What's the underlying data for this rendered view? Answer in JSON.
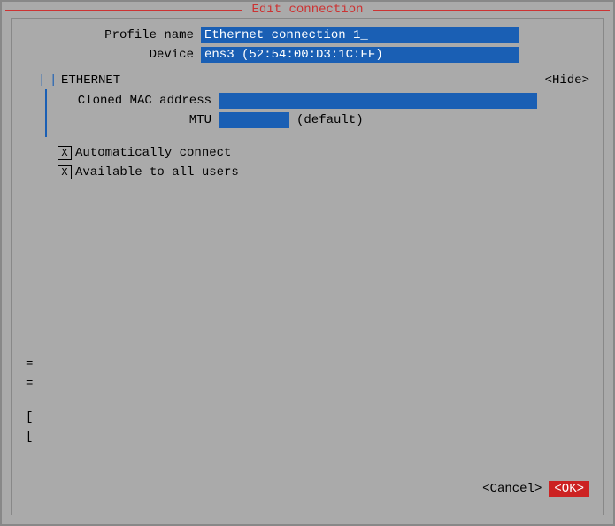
{
  "window": {
    "title": "Edit connection"
  },
  "form": {
    "profile_name_label": "Profile name",
    "profile_name_value": "Ethernet connection 1_",
    "device_label": "Device",
    "device_value": "ens3 (52:54:00:D3:1C:FF)",
    "ethernet_section_title": "ETHERNET",
    "hide_button": "<Hide>",
    "cloned_mac_label": "Cloned MAC address",
    "cloned_mac_value": "",
    "mtu_label": "MTU",
    "mtu_value": "",
    "mtu_default_text": "(default)",
    "auto_connect_label": "Automatically connect",
    "auto_connect_checked": true,
    "all_users_label": "Available to all users",
    "all_users_checked": true,
    "cancel_button": "<Cancel>",
    "ok_button": "<OK>"
  },
  "sidebar": {
    "marks": [
      "=",
      "="
    ],
    "bottom_marks": [
      "[",
      "["
    ]
  }
}
